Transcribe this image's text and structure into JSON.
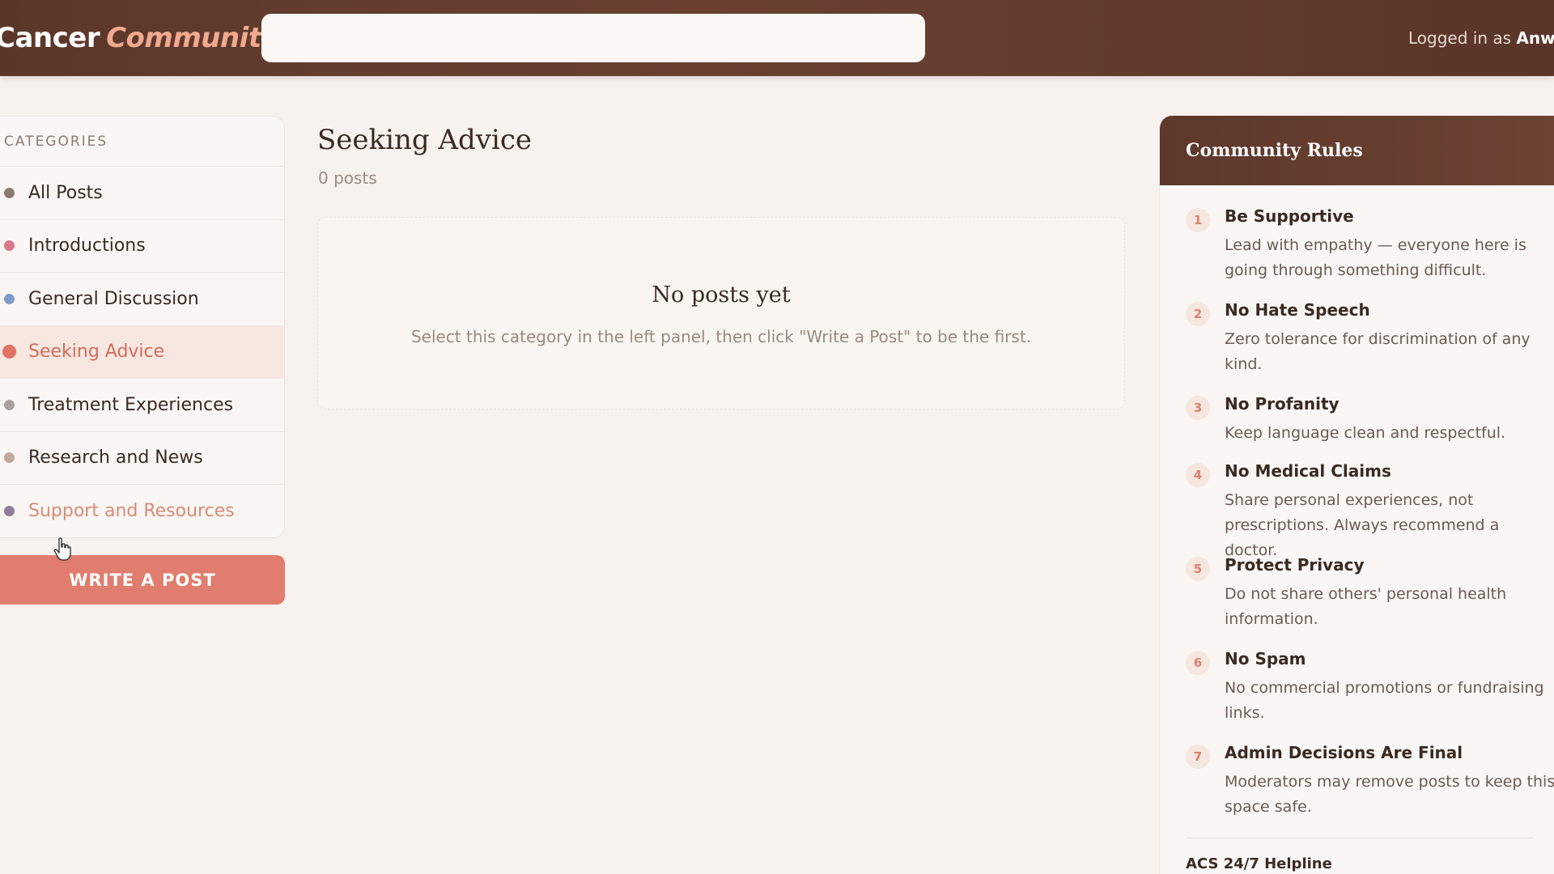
{
  "header": {
    "brand_part1": "Cancer",
    "brand_part2": "Community",
    "search_placeholder": "",
    "login_prefix": "Logged in as",
    "login_user": "Anwit"
  },
  "sidebar": {
    "heading": "CATEGORIES",
    "items": [
      {
        "label": "All Posts",
        "dot_color": "#8b7a72"
      },
      {
        "label": "Introductions",
        "dot_color": "#d9788a"
      },
      {
        "label": "General Discussion",
        "dot_color": "#7e9cc8"
      },
      {
        "label": "Seeking Advice",
        "dot_color": "#e07361"
      },
      {
        "label": "Treatment Experiences",
        "dot_color": "#a9a19c"
      },
      {
        "label": "Research and News",
        "dot_color": "#c2a79b"
      },
      {
        "label": "Support and Resources",
        "dot_color": "#8e7d9c"
      }
    ],
    "active_index": 3,
    "write_button": "WRITE A POST"
  },
  "main": {
    "title": "Seeking Advice",
    "post_count": "0 posts",
    "empty_title": "No posts yet",
    "empty_subtitle": "Select this category in the left panel, then click \"Write a Post\" to be the first."
  },
  "rules": {
    "heading": "Community Rules",
    "items": [
      {
        "num": "1",
        "title": "Be Supportive",
        "desc": "Lead with empathy — everyone here is going through something difficult."
      },
      {
        "num": "2",
        "title": "No Hate Speech",
        "desc": "Zero tolerance for discrimination of any kind."
      },
      {
        "num": "3",
        "title": "No Profanity",
        "desc": "Keep language clean and respectful."
      },
      {
        "num": "4",
        "title": "No Medical Claims",
        "desc": "Share personal experiences, not prescriptions. Always recommend a doctor."
      },
      {
        "num": "5",
        "title": "Protect Privacy",
        "desc": "Do not share others' personal health information."
      },
      {
        "num": "6",
        "title": "No Spam",
        "desc": "No commercial promotions or fundraising links."
      },
      {
        "num": "7",
        "title": "Admin Decisions Are Final",
        "desc": "Moderators may remove posts to keep this space safe."
      }
    ],
    "helpline": "ACS 24/7 Helpline"
  },
  "colors": {
    "accent": "#e07d6e",
    "header_bg": "#5b372a",
    "active_bg": "#f8e6e1"
  }
}
